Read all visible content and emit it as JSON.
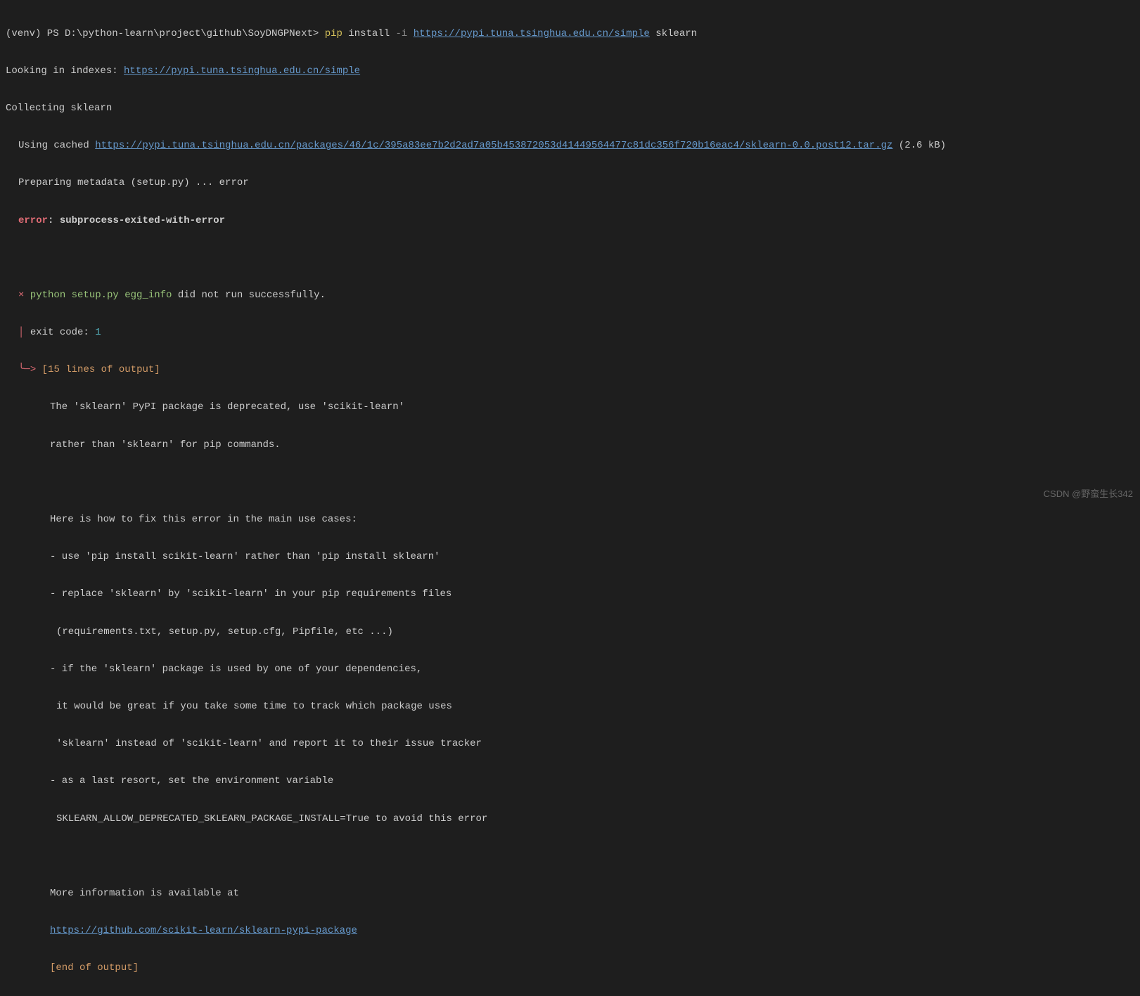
{
  "prompt": {
    "prefix": "(venv) PS D:\\python-learn\\project\\github\\SoyDNGPNext> ",
    "pip": "pip",
    "install": " install ",
    "dash_i": "-i ",
    "url": "https://pypi.tuna.tsinghua.edu.cn/simple",
    "pkg": " sklearn"
  },
  "l2": {
    "prefix": "Looking in indexes: ",
    "url": "https://pypi.tuna.tsinghua.edu.cn/simple"
  },
  "l3": "Collecting sklearn",
  "l4": {
    "prefix": "Using cached ",
    "url": "https://pypi.tuna.tsinghua.edu.cn/packages/46/1c/395a83ee7b2d2ad7a05b453872053d41449564477c81dc356f720b16eac4/sklearn-0.0.post12.tar.gz",
    "size": " (2.6 kB)"
  },
  "l5": "Preparing metadata (setup.py) ... error",
  "l6": {
    "error_label": "error",
    "colon": ": ",
    "msg": "subprocess-exited-with-error"
  },
  "l8": {
    "cross": "×",
    "python": " python",
    "setup": " setup.py",
    "egg": " egg_info",
    "rest": " did not run successfully."
  },
  "l9": {
    "pipe": "│ ",
    "label": "exit code: ",
    "code": "1"
  },
  "l10": {
    "arrow": "╰─> ",
    "text": "[15 lines of output]"
  },
  "out": {
    "a": "The 'sklearn' PyPI package is deprecated, use 'scikit-learn'",
    "b": "rather than 'sklearn' for pip commands.",
    "c": "Here is how to fix this error in the main use cases:",
    "d": "- use 'pip install scikit-learn' rather than 'pip install sklearn'",
    "e": "- replace 'sklearn' by 'scikit-learn' in your pip requirements files",
    "f": "(requirements.txt, setup.py, setup.cfg, Pipfile, etc ...)",
    "g": "- if the 'sklearn' package is used by one of your dependencies,",
    "h": "it would be great if you take some time to track which package uses",
    "i": "'sklearn' instead of 'scikit-learn' and report it to their issue tracker",
    "j": "- as a last resort, set the environment variable",
    "k": "SKLEARN_ALLOW_DEPRECATED_SKLEARN_PACKAGE_INSTALL=True to avoid this error",
    "l": "More information is available at",
    "url": "https://github.com/scikit-learn/sklearn-pypi-package",
    "end": "[end of output]"
  },
  "watermark": "CSDN @野蛮生长342"
}
